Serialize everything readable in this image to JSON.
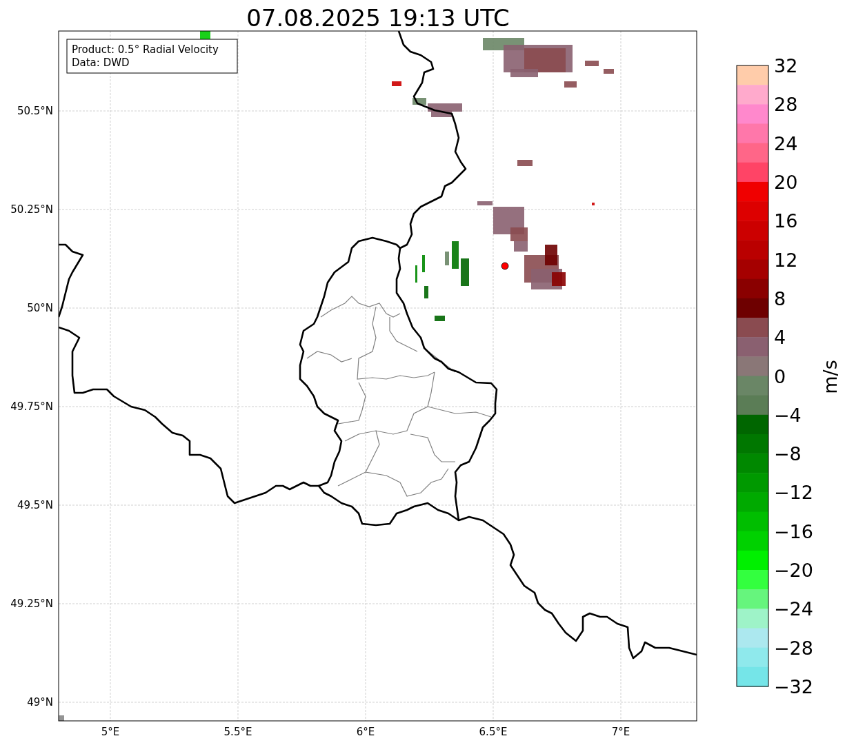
{
  "title": "07.08.2025 19:13 UTC",
  "info_box": {
    "lines": [
      "Product: 0.5° Radial Velocity",
      "Data: DWD"
    ]
  },
  "map": {
    "lat_labels": [
      "50.5°N",
      "50.25°N",
      "50°N",
      "49.75°N",
      "49.5°N",
      "49.25°N",
      "49°N"
    ],
    "lon_labels": [
      "5°E",
      "5.5°E",
      "6°E",
      "6.5°E",
      "7°E"
    ]
  },
  "colorbar": {
    "label": "m/s",
    "tick_labels": [
      "32",
      "28",
      "24",
      "20",
      "16",
      "12",
      "8",
      "4",
      "0",
      "−4",
      "−8",
      "−12",
      "−16",
      "−20",
      "−24",
      "−28",
      "−32"
    ],
    "bands": [
      {
        "color": "#ffccaa"
      },
      {
        "color": "#ffaacc"
      },
      {
        "color": "#ff88cc"
      },
      {
        "color": "#ff77aa"
      },
      {
        "color": "#ff6688"
      },
      {
        "color": "#ff4466"
      },
      {
        "color": "#f00000"
      },
      {
        "color": "#dd0000"
      },
      {
        "color": "#cc0000"
      },
      {
        "color": "#ba0000"
      },
      {
        "color": "#a50000"
      },
      {
        "color": "#8a0000"
      },
      {
        "color": "#6e0000"
      },
      {
        "color": "#8a4b50"
      },
      {
        "color": "#8a6070"
      },
      {
        "color": "#8a7777"
      },
      {
        "color": "#6a8666"
      },
      {
        "color": "#5b7d56"
      },
      {
        "color": "#006600"
      },
      {
        "color": "#007700"
      },
      {
        "color": "#008800"
      },
      {
        "color": "#009900"
      },
      {
        "color": "#00aa00"
      },
      {
        "color": "#00be00"
      },
      {
        "color": "#00d100"
      },
      {
        "color": "#00f000"
      },
      {
        "color": "#33ff3f"
      },
      {
        "color": "#66f57d"
      },
      {
        "color": "#9ef3c8"
      },
      {
        "color": "#ace8ef"
      },
      {
        "color": "#8fe9ec"
      },
      {
        "color": "#75e5e8"
      }
    ]
  }
}
